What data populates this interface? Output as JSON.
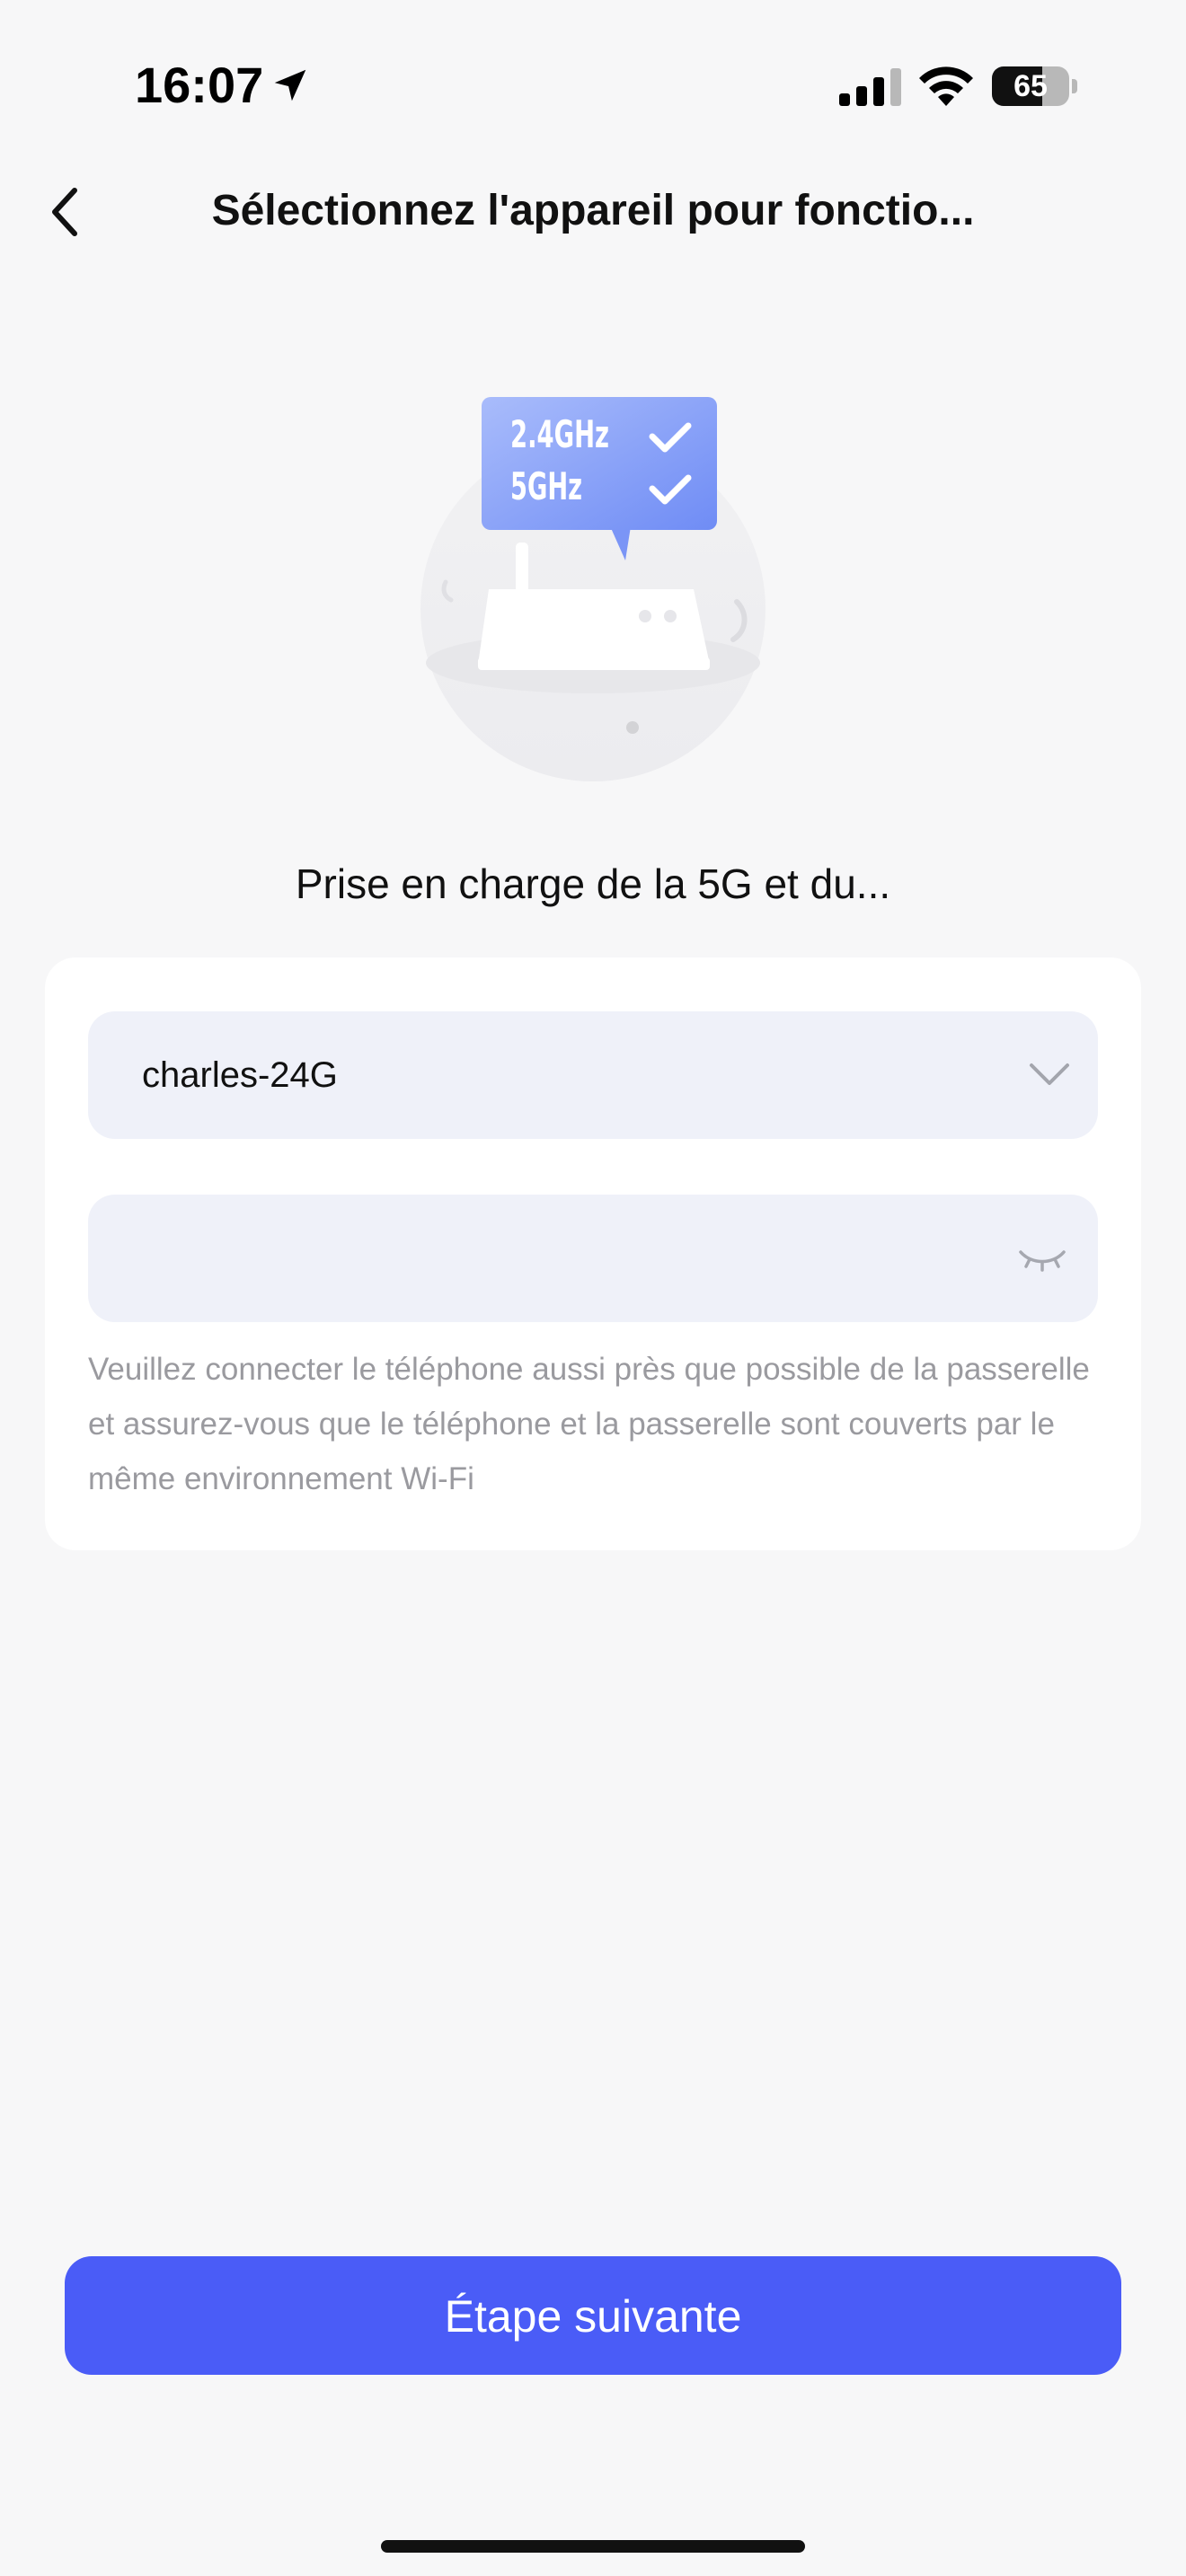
{
  "status_bar": {
    "time": "16:07",
    "battery_level": "65",
    "battery_fraction": 0.65,
    "icons": [
      "location-arrow-icon",
      "cellular-signal-icon",
      "wifi-icon",
      "battery-icon"
    ]
  },
  "header": {
    "back_icon": "chevron-left-icon",
    "title": "Sélectionnez l'appareil pour fonctio..."
  },
  "illustration": {
    "bubble_line_1": "2.4GHz",
    "bubble_line_2": "5GHz",
    "icons": [
      "router-icon",
      "check-icon"
    ],
    "accent_color": "#6f8cf5"
  },
  "subtitle": "Prise en charge de la 5G et du...",
  "form": {
    "ssid_value": "charles-24G",
    "ssid_icon": "chevron-down-icon",
    "password_value": "",
    "password_icon": "eye-off-icon",
    "hint": "Veuillez connecter le téléphone aussi près que possible de la passerelle et assurez-vous que le téléphone et la passerelle sont couverts par le même environnement Wi-Fi"
  },
  "actions": {
    "next_label": "Étape suivante",
    "primary_color": "#4a5cf7"
  }
}
